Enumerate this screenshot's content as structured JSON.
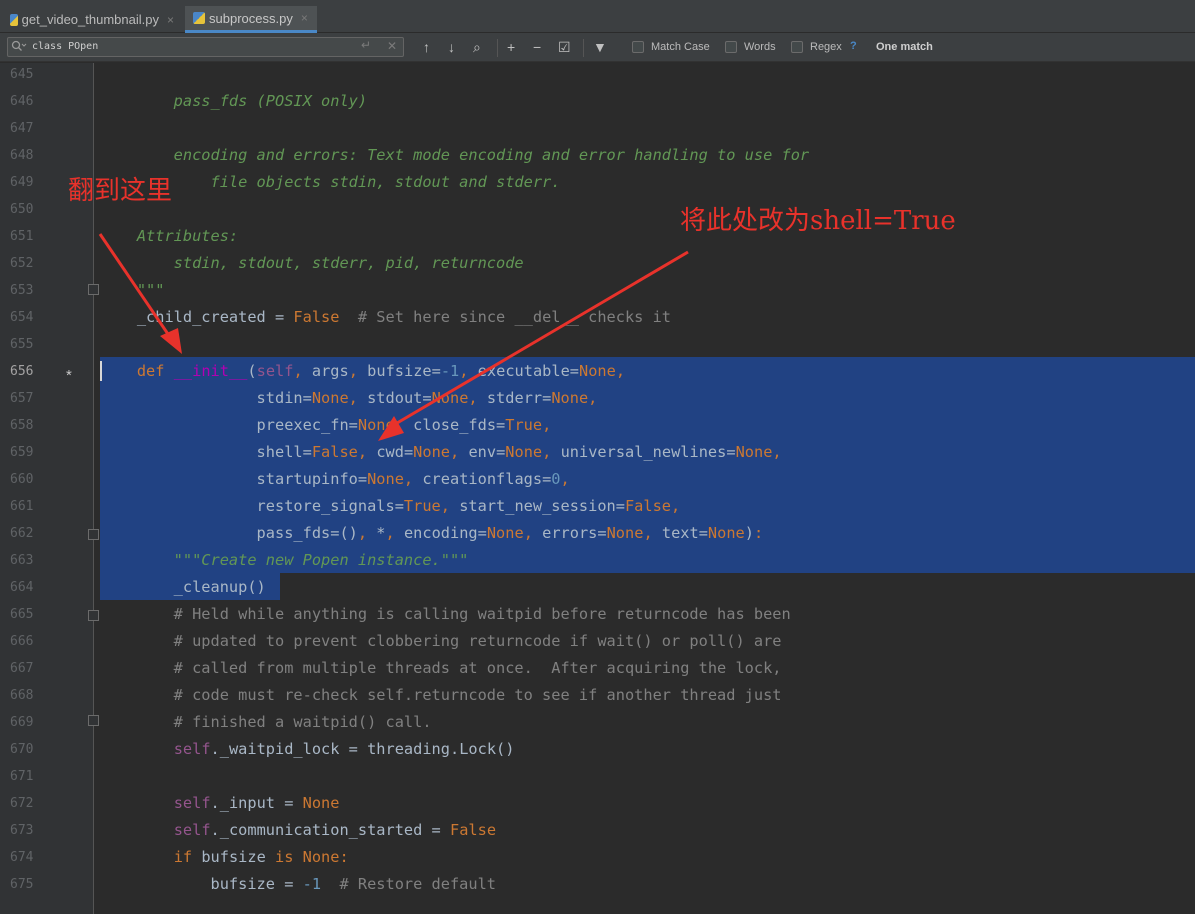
{
  "tabs": [
    {
      "label": "get_video_thumbnail.py",
      "close": "×",
      "active": false
    },
    {
      "label": "subprocess.py",
      "close": "×",
      "active": true
    }
  ],
  "find": {
    "query": "class POpen",
    "match_case": "Match Case",
    "words": "Words",
    "regex": "Regex",
    "help": "?",
    "status": "One match"
  },
  "icons": {
    "search": "search-icon",
    "enter": "↵",
    "clear": "✕",
    "up": "↑",
    "down": "↓",
    "find_all": "⌕",
    "add_occurrence": "+",
    "remove_occurrence": "−",
    "select_all": "☑",
    "filter": "▼"
  },
  "editor": {
    "bookmark": "*",
    "current_line": "656",
    "line_numbers": [
      "645",
      "646",
      "647",
      "648",
      "649",
      "650",
      "651",
      "652",
      "653",
      "654",
      "655",
      "656",
      "657",
      "658",
      "659",
      "660",
      "661",
      "662",
      "663",
      "664",
      "665",
      "666",
      "667",
      "668",
      "669",
      "670",
      "671",
      "672",
      "673",
      "674",
      "675"
    ],
    "lines": [
      "",
      "        pass_fds (POSIX only)",
      "",
      "        encoding and errors: Text mode encoding and error handling to use for",
      "            file objects stdin, stdout and stderr.",
      "",
      "    Attributes:",
      "        stdin, stdout, stderr, pid, returncode",
      "    \"\"\"",
      "    _child_created = False  # Set here since __del__ checks it",
      "",
      "    def __init__(self, args, bufsize=-1, executable=None,",
      "                 stdin=None, stdout=None, stderr=None,",
      "                 preexec_fn=None, close_fds=True,",
      "                 shell=False, cwd=None, env=None, universal_newlines=None,",
      "                 startupinfo=None, creationflags=0,",
      "                 restore_signals=True, start_new_session=False,",
      "                 pass_fds=(), *, encoding=None, errors=None, text=None):",
      "        \"\"\"Create new Popen instance.\"\"\"",
      "        _cleanup()",
      "        # Held while anything is calling waitpid before returncode has been",
      "        # updated to prevent clobbering returncode if wait() or poll() are",
      "        # called from multiple threads at once.  After acquiring the lock,",
      "        # code must re-check self.returncode to see if another thread just",
      "        # finished a waitpid() call.",
      "        self._waitpid_lock = threading.Lock()",
      "",
      "        self._input = None",
      "        self._communication_started = False",
      "        if bufsize is None:",
      "            bufsize = -1  # Restore default"
    ]
  },
  "annotations": {
    "scroll_here": "翻到这里",
    "change_here": "将此处改为shell=True"
  },
  "colors": {
    "background": "#2b2b2b",
    "selection": "#214283",
    "keyword": "#cc7832",
    "docstring": "#629755",
    "annotation": "#e8322b"
  }
}
